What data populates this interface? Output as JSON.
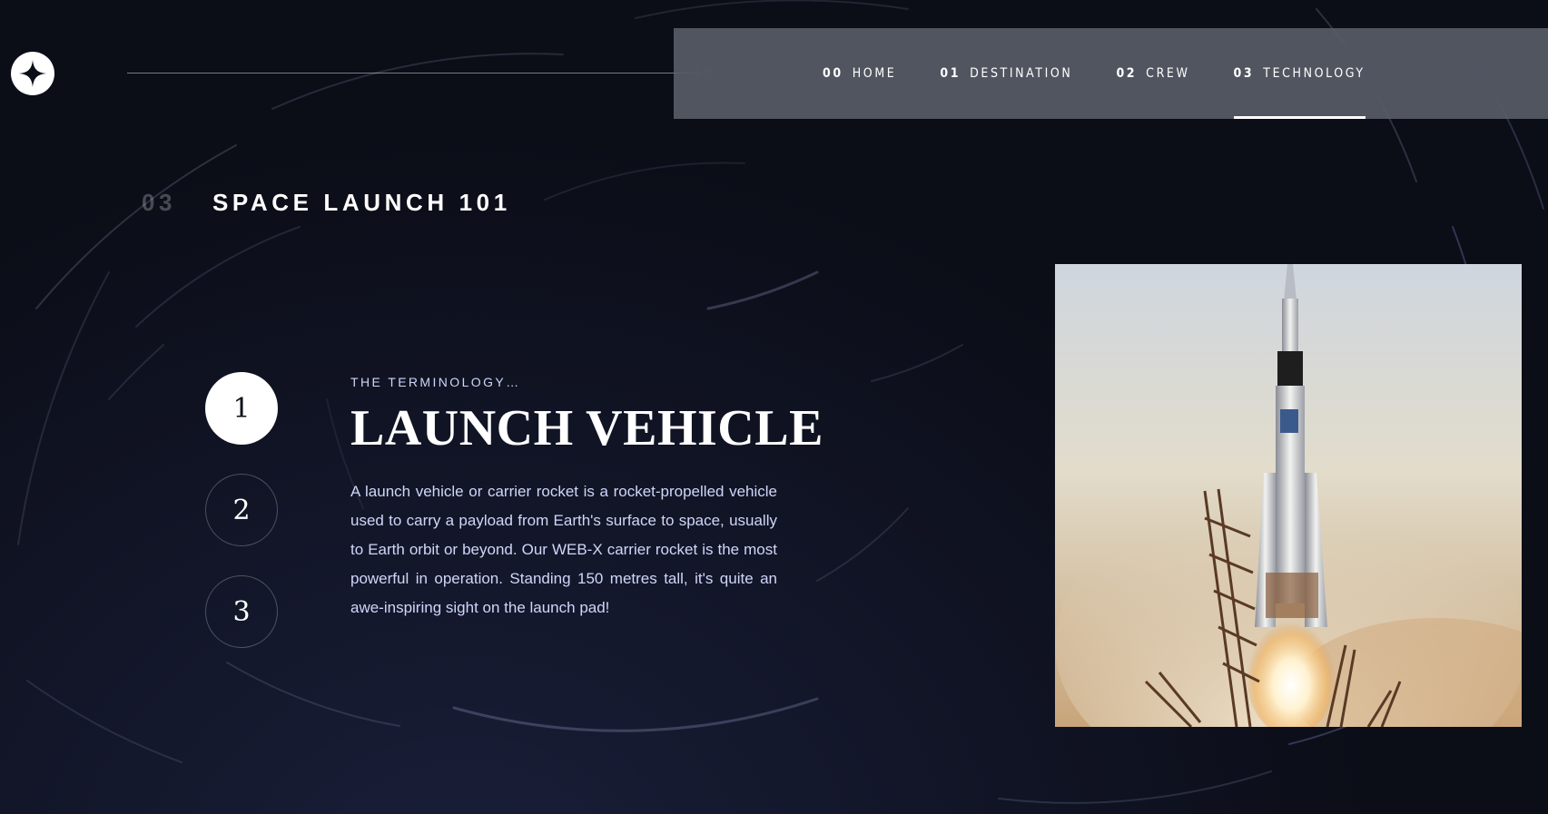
{
  "nav": {
    "items": [
      {
        "num": "00",
        "label": "HOME"
      },
      {
        "num": "01",
        "label": "DESTINATION"
      },
      {
        "num": "02",
        "label": "CREW"
      },
      {
        "num": "03",
        "label": "TECHNOLOGY",
        "active": true
      }
    ]
  },
  "page": {
    "heading_num": "03",
    "heading": "SPACE LAUNCH 101"
  },
  "steps": [
    "1",
    "2",
    "3"
  ],
  "active_step": "1",
  "content": {
    "eyebrow": "THE TERMINOLOGY…",
    "title": "LAUNCH VEHICLE",
    "description": "A launch vehicle or carrier rocket is a rocket-propelled vehicle used to carry a payload from Earth's surface to space, usually to Earth orbit or beyond. Our WEB-X carrier rocket is the most powerful in operation. Standing 150 metres tall, it's quite an awe-inspiring sight on the launch pad!"
  },
  "icons": {
    "logo": "four-point-star-icon",
    "rocket_image": "rocket-launch-photo"
  },
  "colors": {
    "background": "#0b0d17",
    "accent_text": "#d0d6f9",
    "nav_bg": "rgba(108,113,125,0.72)"
  }
}
